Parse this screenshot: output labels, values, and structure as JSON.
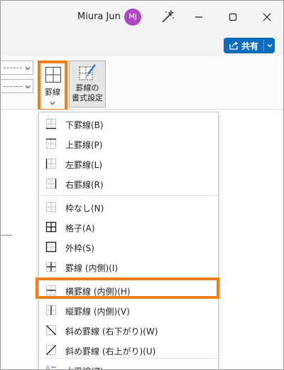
{
  "titlebar": {
    "user_name": "Miura Jun",
    "avatar_initials": "MJ"
  },
  "share": {
    "label": "共有"
  },
  "ribbon": {
    "borders_label": "罫線",
    "format_label_line1": "罫線の",
    "format_label_line2": "書式設定"
  },
  "colors": {
    "accent": "#0f6cbd",
    "highlight": "#f07f17",
    "avatar": "#b146c2"
  },
  "menu": {
    "items": [
      {
        "label": "下罫線(B)",
        "icon": "bottom-border-icon"
      },
      {
        "label": "上罫線(P)",
        "icon": "top-border-icon"
      },
      {
        "label": "左罫線(L)",
        "icon": "left-border-icon"
      },
      {
        "label": "右罫線(R)",
        "icon": "right-border-icon"
      },
      {
        "label": "枠なし(N)",
        "icon": "no-border-icon"
      },
      {
        "label": "格子(A)",
        "icon": "all-borders-icon"
      },
      {
        "label": "外枠(S)",
        "icon": "outside-borders-icon"
      },
      {
        "label": "罫線 (内側)(I)",
        "icon": "inside-borders-icon"
      },
      {
        "label": "横罫線 (内側)(H)",
        "icon": "inside-horizontal-border-icon"
      },
      {
        "label": "縦罫線 (内側)(V)",
        "icon": "inside-vertical-border-icon"
      },
      {
        "label": "斜め罫線 (右下がり)(W)",
        "icon": "diagonal-down-border-icon"
      },
      {
        "label": "斜め罫線 (右上がり)(U)",
        "icon": "diagonal-up-border-icon"
      },
      {
        "label": "水平線(Z)",
        "icon": "horizontal-line-icon"
      }
    ]
  }
}
